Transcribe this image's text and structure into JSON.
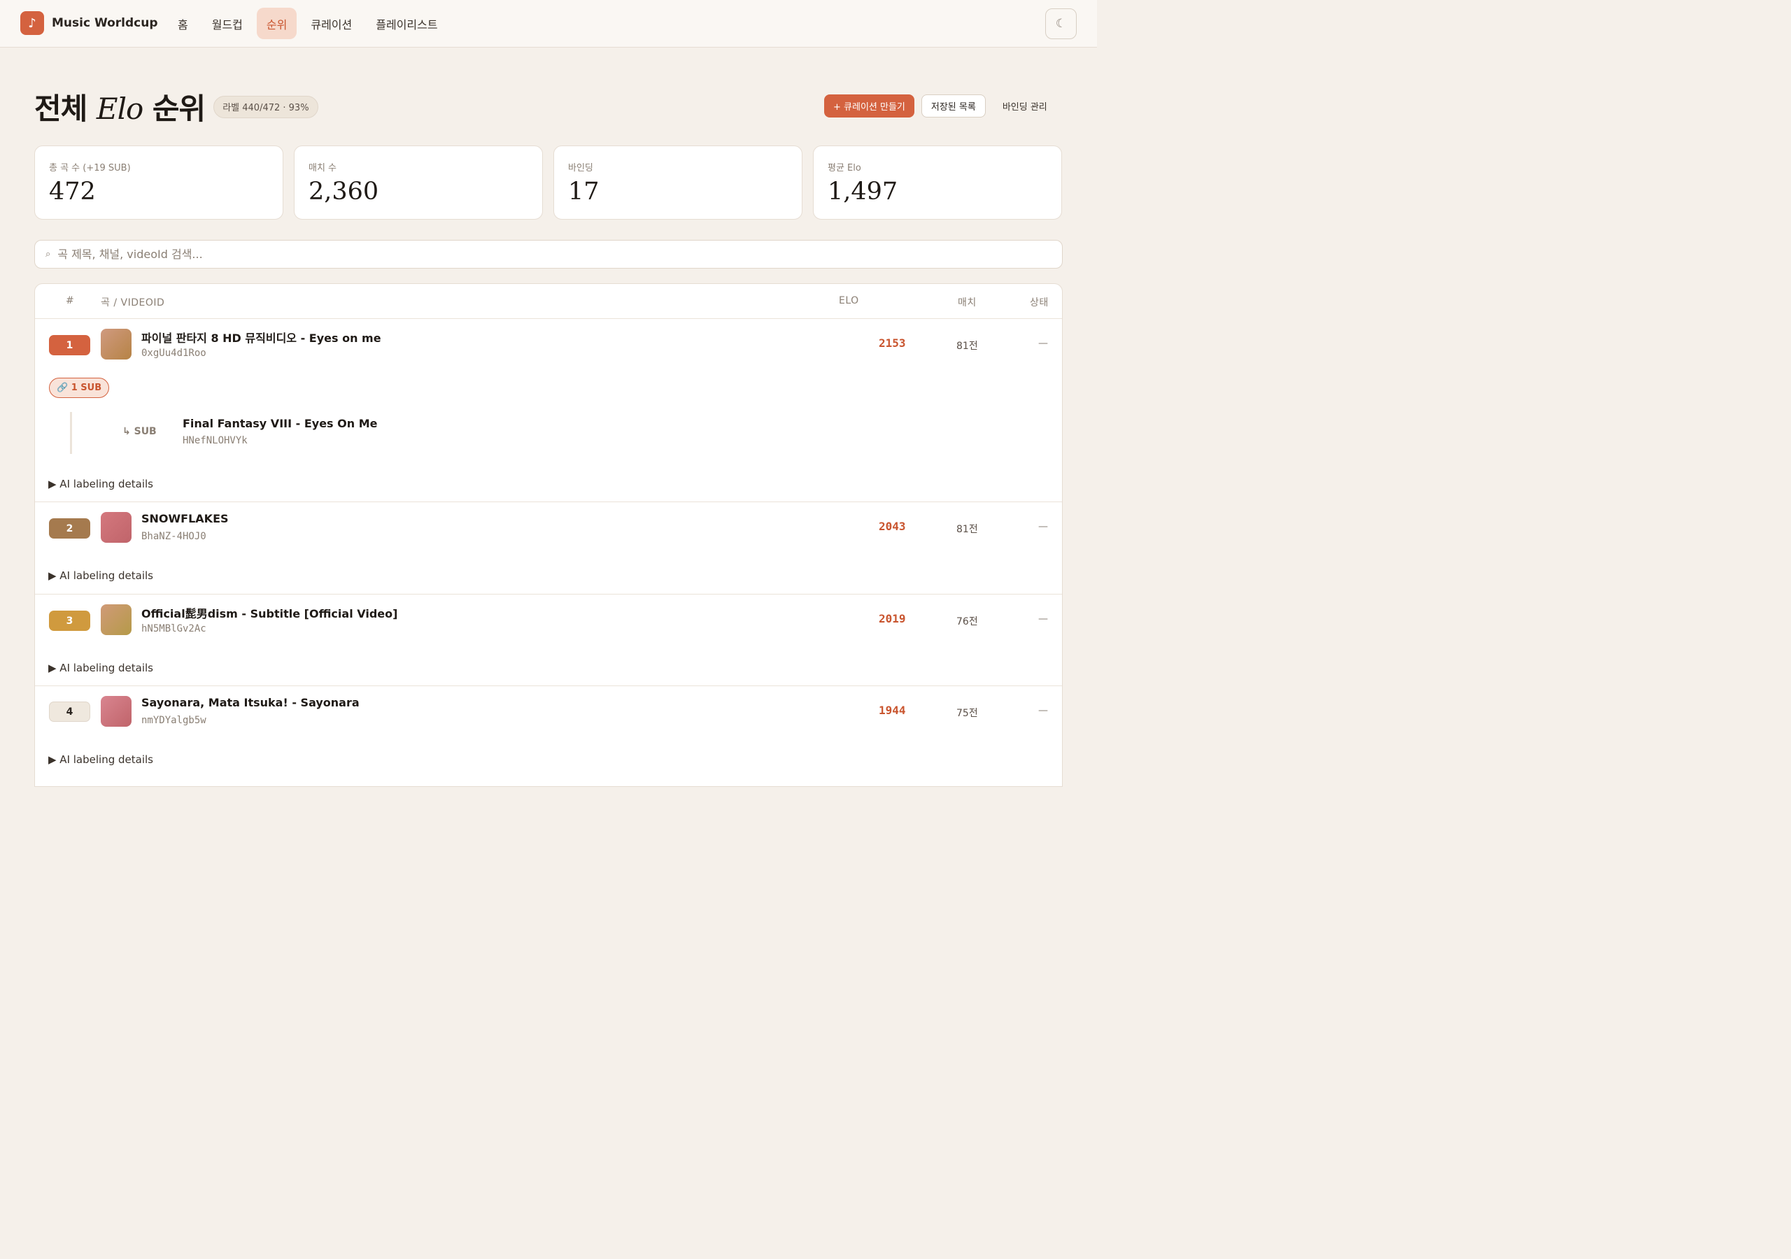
{
  "header": {
    "brand_name": "Music Worldcup",
    "brand_icon": "music-note-icon",
    "nav": [
      "홈",
      "월드컵",
      "순위",
      "큐레이션",
      "플레이리스트"
    ],
    "active_nav": "순위",
    "theme_icon": "moon-icon",
    "theme_glyph": "☾"
  },
  "title": {
    "prefix": "전체",
    "italic": "Elo",
    "suffix": "순위",
    "label_chip": "라벨 440/472 · 93%"
  },
  "actions": {
    "create": "+ 큐레이션 만들기",
    "saved": "저장된 목록",
    "binding": "바인딩 관리"
  },
  "stats": [
    {
      "label": "총 곡 수 (+19 SUB)",
      "value": "472"
    },
    {
      "label": "매치 수",
      "value": "2,360"
    },
    {
      "label": "바인딩",
      "value": "17"
    },
    {
      "label": "평균 Elo",
      "value": "1,497"
    }
  ],
  "search": {
    "icon": "search-icon",
    "glyph": "⌕",
    "placeholder": "곡 제목, 채널, videoId 검색..."
  },
  "table": {
    "headers": {
      "rank": "#",
      "song": "곡 / VIDEOID",
      "elo": "ELO",
      "matches": "매치",
      "status": "상태"
    },
    "ai_label": "▶  AI labeling details",
    "rows": [
      {
        "rank": "1",
        "title": "파이널 판타지 8 HD 뮤직비디오 - Eyes on me",
        "video_id": "0xgUu4d1Roo",
        "elo": "2153",
        "matches": "81전",
        "status": "—",
        "sub_chip": "🔗 1 SUB",
        "sub_tag": "↳ SUB",
        "sub_title": "Final Fantasy VIII - Eyes On Me",
        "sub_video_id": "HNefNLOHVYk"
      },
      {
        "rank": "2",
        "title": "SNOWFLAKES",
        "video_id": "BhaNZ-4HOJ0",
        "elo": "2043",
        "matches": "81전",
        "status": "—"
      },
      {
        "rank": "3",
        "title": "Official髭男dism - Subtitle [Official Video]",
        "video_id": "hN5MBlGv2Ac",
        "elo": "2019",
        "matches": "76전",
        "status": "—"
      },
      {
        "rank": "4",
        "title": "Sayonara, Mata Itsuka! - Sayonara",
        "video_id": "nmYDYalgb5w",
        "elo": "1944",
        "matches": "75전",
        "status": "—"
      }
    ]
  },
  "colors": {
    "accent": "#d4623f",
    "rank1": "#d4623f",
    "rank2": "#a57a4e",
    "rank3": "#d09a3e",
    "rank4": "#efe8de"
  }
}
